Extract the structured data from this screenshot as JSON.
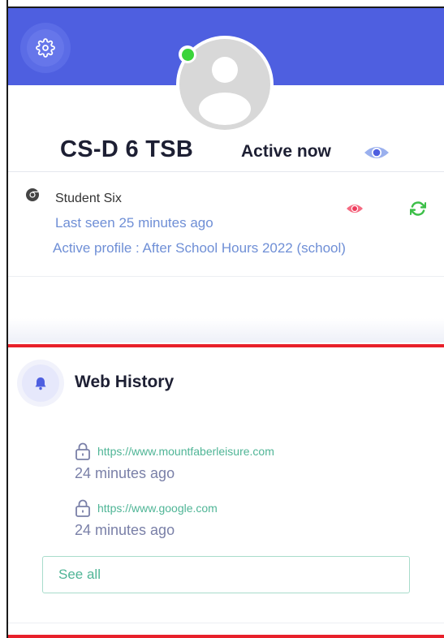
{
  "header": {
    "device_name": "CS-D 6 TSB",
    "active_status": "Active now",
    "online": true
  },
  "student": {
    "name": "Student Six",
    "browser_icon": "chrome-icon",
    "last_seen": "Last seen 25 minutes ago",
    "active_profile": "Active profile : After School Hours 2022 (school)"
  },
  "web_history": {
    "title": "Web History",
    "items": [
      {
        "url": "https://www.mountfaberleisure.com",
        "time": "24 minutes ago"
      },
      {
        "url": "https://www.google.com",
        "time": "24 minutes ago"
      }
    ],
    "see_all_label": "See all"
  },
  "colors": {
    "banner": "#4e5fe0",
    "online_dot": "#3ad43a",
    "accent_red": "#e8202a",
    "link_green": "#4fb596",
    "muted_blue": "#6f8fd6"
  }
}
